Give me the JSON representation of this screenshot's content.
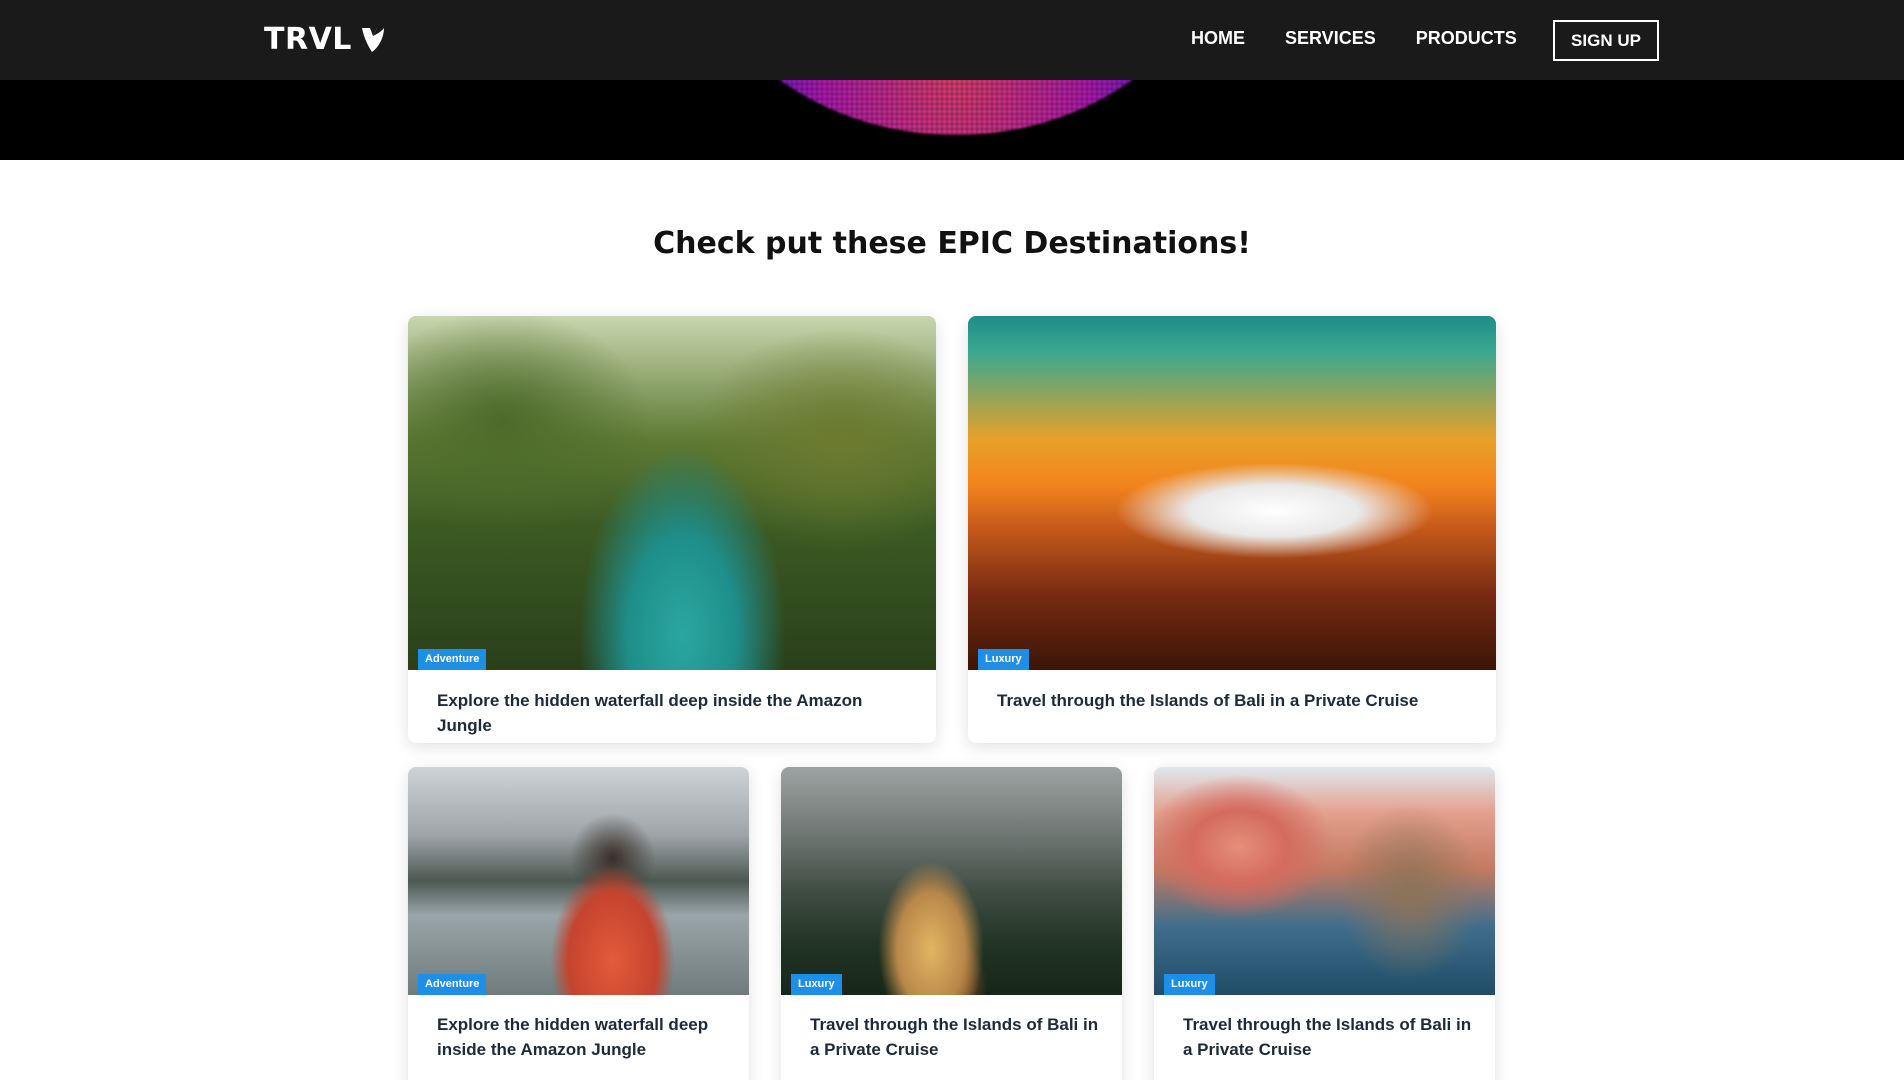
{
  "nav": {
    "brand": "TRVL",
    "links": [
      "HOME",
      "SERVICES",
      "PRODUCTS"
    ],
    "signup_label": "SIGN UP"
  },
  "section": {
    "title": "Check put these EPIC Destinations!"
  },
  "cards": [
    {
      "tag": "Adventure",
      "title": "Explore the hidden waterfall deep inside the Amazon Jungle"
    },
    {
      "tag": "Luxury",
      "title": "Travel through the Islands of Bali in a Private Cruise"
    },
    {
      "tag": "Adventure",
      "title": "Explore the hidden waterfall deep inside the Amazon Jungle"
    },
    {
      "tag": "Luxury",
      "title": "Travel through the Islands of Bali in a Private Cruise"
    },
    {
      "tag": "Luxury",
      "title": "Travel through the Islands of Bali in a Private Cruise"
    }
  ],
  "colors": {
    "nav_bg": "#1a1a1a",
    "tag_bg": "#1e8fe6",
    "title_text": "#1e2a38"
  }
}
